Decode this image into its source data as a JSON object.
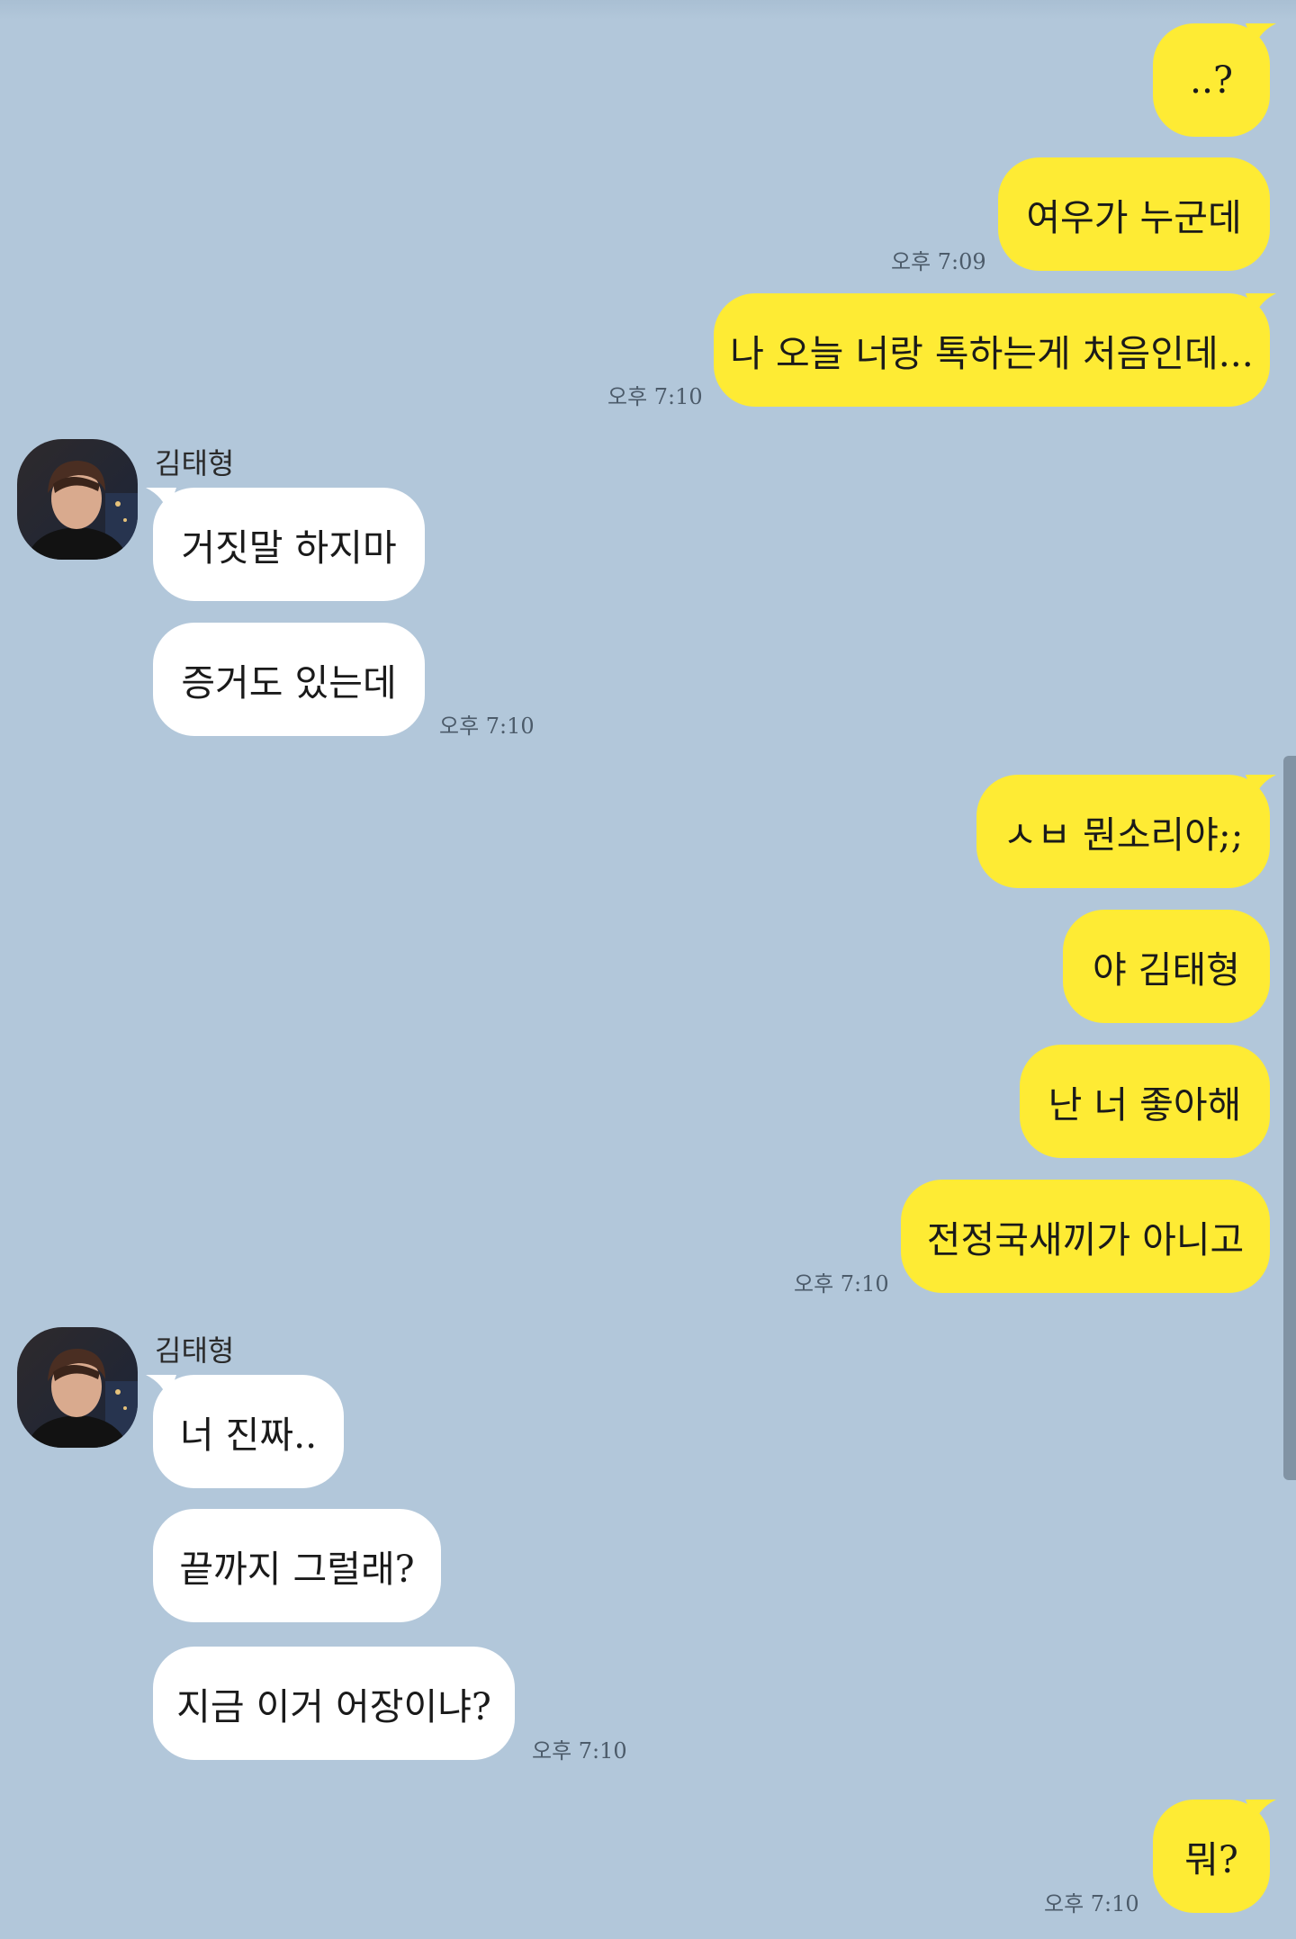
{
  "colors": {
    "background": "#b2c7da",
    "my_bubble": "#feeb34",
    "their_bubble": "#ffffff",
    "timestamp": "#4c5b6a"
  },
  "contact": {
    "name": "김태형"
  },
  "messages": [
    {
      "side": "me",
      "text": "..?",
      "time": ""
    },
    {
      "side": "me",
      "text": "여우가 누군데",
      "time": "오후 7:09"
    },
    {
      "side": "me",
      "text": "나 오늘 너랑 톡하는게 처음인데...",
      "time": "오후 7:10"
    },
    {
      "side": "them",
      "sender": "김태형",
      "text": "거짓말 하지마",
      "time": ""
    },
    {
      "side": "them",
      "text": "증거도 있는데",
      "time": "오후 7:10"
    },
    {
      "side": "me",
      "text": "ㅅㅂ 뭔소리야;;",
      "time": ""
    },
    {
      "side": "me",
      "text": "야 김태형",
      "time": ""
    },
    {
      "side": "me",
      "text": "난 너 좋아해",
      "time": ""
    },
    {
      "side": "me",
      "text": "전정국새끼가 아니고",
      "time": "오후 7:10"
    },
    {
      "side": "them",
      "sender": "김태형",
      "text": "너 진짜..",
      "time": ""
    },
    {
      "side": "them",
      "text": "끝까지 그럴래?",
      "time": ""
    },
    {
      "side": "them",
      "text": "지금 이거 어장이냐?",
      "time": "오후 7:10"
    },
    {
      "side": "me",
      "text": "뭐?",
      "time": "오후 7:10"
    }
  ]
}
